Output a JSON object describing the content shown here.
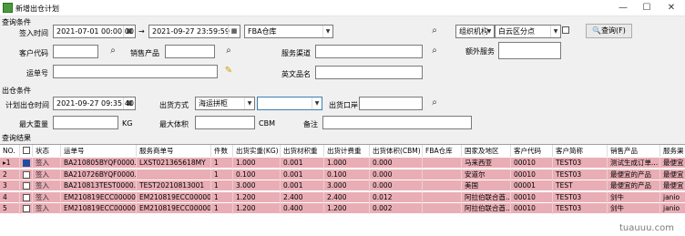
{
  "window": {
    "title": "新增出仓计划",
    "min": "—",
    "max": "☐",
    "close": "✕"
  },
  "query": {
    "group": "查询条件",
    "sign_time_label": "签入时间",
    "sign_start": "2021-07-01 00:00:00",
    "sign_end": "2021-09-27 23:59:59",
    "arrow": "→",
    "fba_select": "FBA仓库",
    "org_select": "组织机构",
    "org_value": "白云区分点",
    "query_btn": "查询(F)",
    "customer_code_label": "客户代码",
    "sales_product_label": "销售产品",
    "service_channel_label": "服务渠道",
    "extra_service_label": "额外服务",
    "waybill_label": "运单号",
    "english_name_label": "英文品名"
  },
  "out": {
    "group": "出仓条件",
    "plan_time_label": "计划出仓时间",
    "plan_time": "2021-09-27 09:35:40",
    "method_label": "出货方式",
    "method_value": "海运拼柜",
    "port_label": "出货口岸",
    "max_weight_label": "最大重量",
    "kg": "KG",
    "max_volume_label": "最大体积",
    "cbm": "CBM",
    "remark_label": "备注"
  },
  "results": {
    "group": "查询结果",
    "headers": [
      "NO.",
      "",
      "状态",
      "运单号",
      "服务商单号",
      "件数",
      "出货实重(KG)",
      "出货材积重",
      "出货计费重",
      "出货体积(CBM)",
      "FBA仓库",
      "国家及地区",
      "客户代码",
      "客户简称",
      "销售产品",
      "服务渠"
    ],
    "rows": [
      [
        "1",
        "签入",
        "BA210805BYQF0000...",
        "LXST021365618MY",
        "1",
        "1.000",
        "0.001",
        "1.000",
        "0.000",
        "",
        "马来西亚",
        "00010",
        "TEST03",
        "测试生成订单...",
        "最便宜"
      ],
      [
        "2",
        "签入",
        "BA210726BYQF0000...",
        "",
        "1",
        "0.100",
        "0.001",
        "0.100",
        "0.000",
        "",
        "安道尔",
        "00010",
        "TEST03",
        "最便宜的产品",
        "最便宜"
      ],
      [
        "3",
        "签入",
        "BA210813TEST0000...",
        "TEST20210813001",
        "1",
        "3.000",
        "0.001",
        "3.000",
        "0.000",
        "",
        "美国",
        "00001",
        "TEST",
        "最便宜的产品",
        "最便宜"
      ],
      [
        "4",
        "签入",
        "EM210819ECC00000...",
        "EM210819ECC00000...",
        "1",
        "1.200",
        "2.400",
        "2.400",
        "0.012",
        "",
        "阿拉伯联合酋...",
        "00010",
        "TEST03",
        "剑牛",
        "janio"
      ],
      [
        "5",
        "签入",
        "EM210819ECC00000...",
        "EM210819ECC00000...",
        "1",
        "1.200",
        "0.400",
        "1.200",
        "0.002",
        "",
        "阿拉伯联合酋...",
        "00010",
        "TEST03",
        "剑牛",
        "janio"
      ]
    ]
  },
  "watermark": "tuauuu.com"
}
